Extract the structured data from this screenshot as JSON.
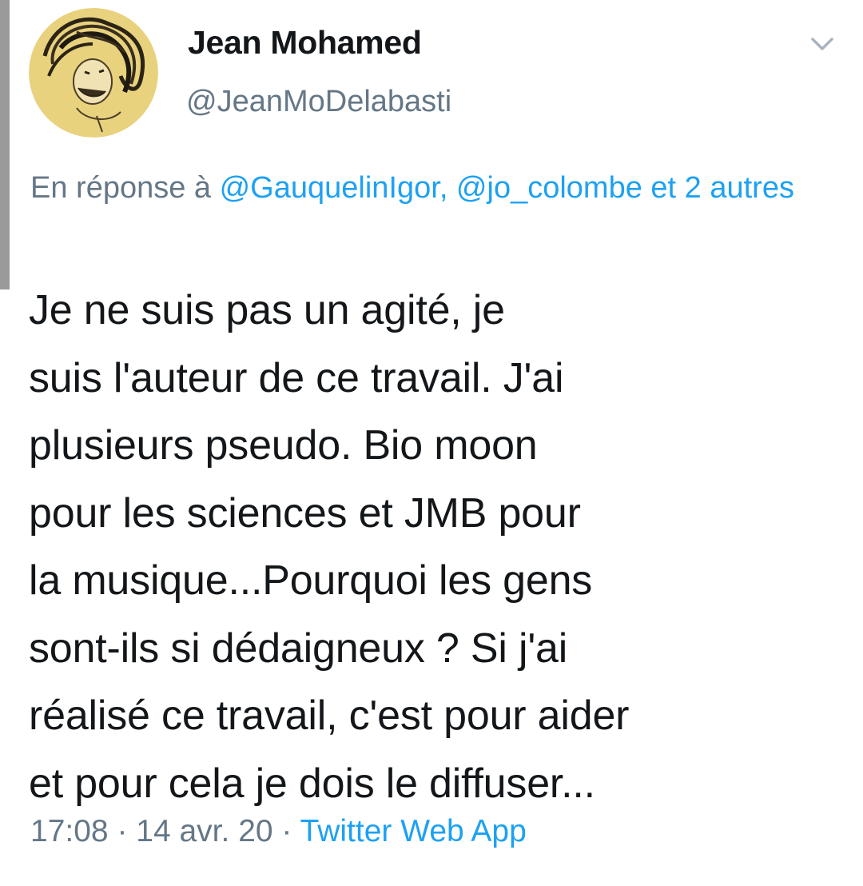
{
  "tweet": {
    "author": {
      "display_name": "Jean Mohamed",
      "handle": "@JeanMoDelabasti"
    },
    "menu_icon": "chevron-down-icon",
    "reply_to": {
      "prefix": "En réponse à ",
      "mentions": "@GauquelinIgor, @jo_colombe",
      "suffix": " et 2 autres"
    },
    "text": "Je ne suis pas un agité, je\nsuis l'auteur de ce travail. J'ai\nplusieurs pseudo. Bio moon\npour les sciences et JMB pour\nla musique...Pourquoi les gens\nsont-ils si dédaigneux ? Si j'ai\nréalisé ce travail, c'est pour aider\net pour cela je dois le diffuser...",
    "time": "17:08",
    "separator": " · ",
    "date": "14 avr. 20",
    "source": "Twitter Web App"
  },
  "colors": {
    "text": "#14171a",
    "secondary": "#657786",
    "link": "#1da1f2",
    "avatar_bg": "#e8d27e"
  }
}
